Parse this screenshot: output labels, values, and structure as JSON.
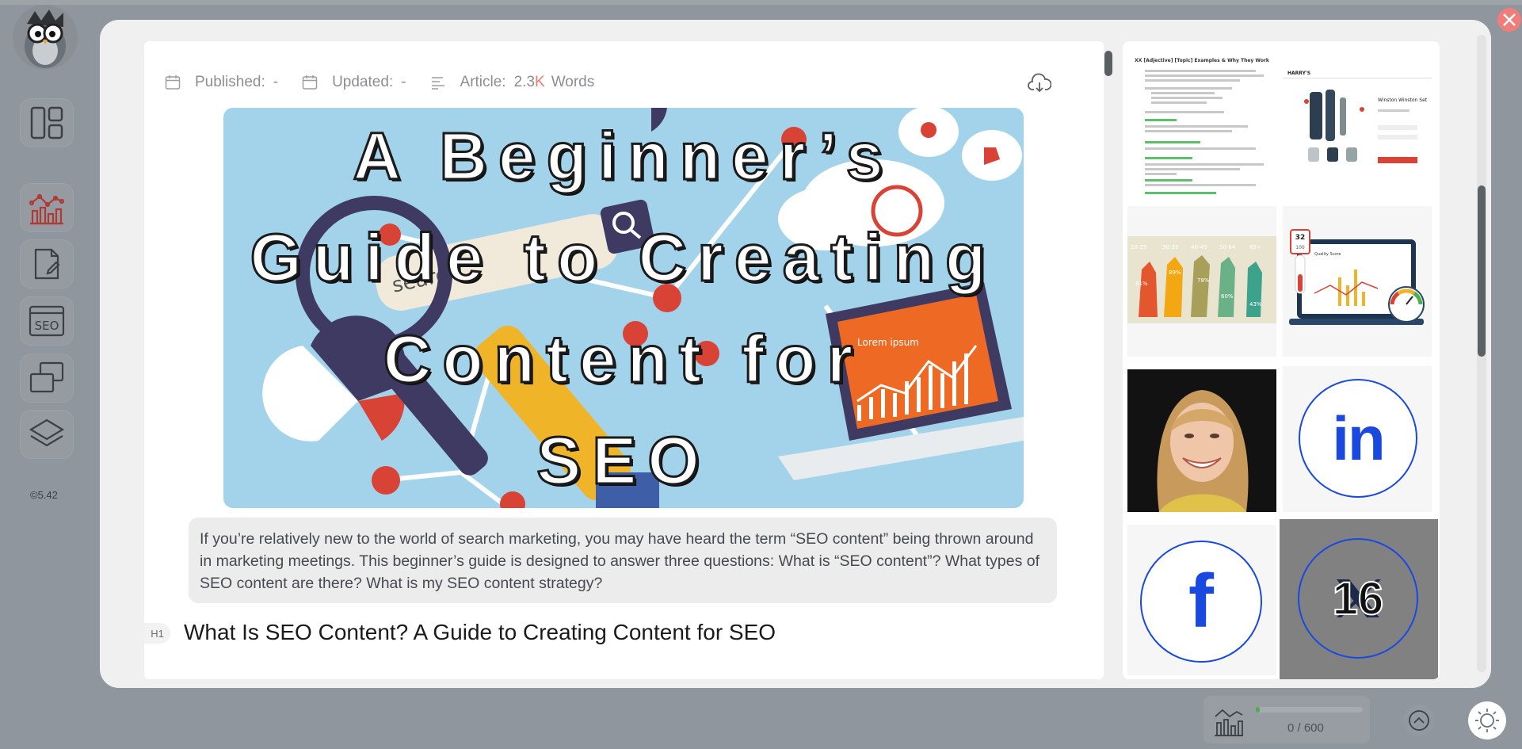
{
  "sidebar": {
    "version": "©5.42",
    "items": [
      {
        "icon": "dashboard-icon"
      },
      {
        "icon": "analytics-icon"
      },
      {
        "icon": "document-edit-icon"
      },
      {
        "icon": "seo-icon"
      },
      {
        "icon": "copy-icon"
      },
      {
        "icon": "layers-icon"
      }
    ]
  },
  "article": {
    "published_label": "Published:",
    "published_value": "-",
    "updated_label": "Updated:",
    "updated_value": "-",
    "article_label": "Article:",
    "words_number": "2.3",
    "words_unit": "K",
    "words_label": "Words",
    "hero_lines": [
      "A Beginner’s",
      "Guide to Creating",
      "Content for",
      "SEO"
    ],
    "hero_search_text": "search",
    "hero_laptop_text": "Lorem ipsum",
    "summary": "If you’re relatively new to the world of search marketing, you may have heard the term “SEO content” being thrown around in marketing meetings. This beginner’s guide is designed to answer three questions: What is “SEO content”? What types of SEO content are there? What is my SEO content strategy?",
    "heading_tag": "H1",
    "heading": "What Is SEO Content? A Guide to Creating Content for SEO"
  },
  "gallery": {
    "doc_thumb_title": "XX [Adjective] [Topic] Examples & Why They Work",
    "product_thumb_brand": "HARRY'S",
    "product_thumb_title": "Winston Winston Set",
    "age_labels": [
      "20-29",
      "30-39",
      "40-49",
      "50-64",
      "65+"
    ],
    "age_values": [
      "81%",
      "89%",
      "78%",
      "60%",
      "43%"
    ],
    "score_value": "32",
    "score_total": "100",
    "score_label": "Quality Score",
    "linkedin_label": "in",
    "facebook_label": "f",
    "overlay_number": "16"
  },
  "stats": {
    "count": "0 / 600",
    "progress_fraction": 0.0
  },
  "colors": {
    "accent_red": "#e97c6f",
    "progress_green": "#4caf50",
    "social_blue": "#1a49e0"
  }
}
